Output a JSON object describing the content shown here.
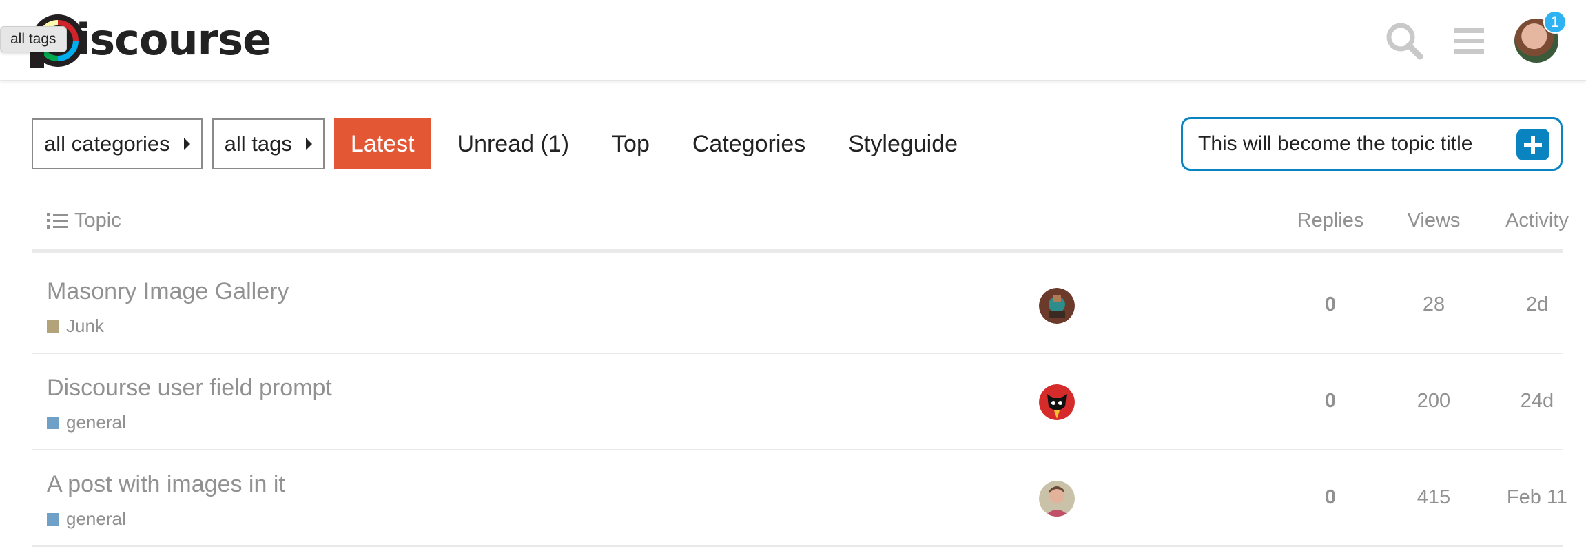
{
  "header": {
    "logo_text": "iscourse",
    "tooltip": "all tags",
    "notification_count": "1"
  },
  "nav": {
    "categories_dropdown": "all categories",
    "tags_dropdown": "all tags",
    "links": [
      "Latest",
      "Unread (1)",
      "Top",
      "Categories",
      "Styleguide"
    ],
    "active": "Latest"
  },
  "composer": {
    "value": "This will become the topic title"
  },
  "table": {
    "headers": {
      "topic": "Topic",
      "replies": "Replies",
      "views": "Views",
      "activity": "Activity"
    },
    "rows": [
      {
        "title": "Masonry Image Gallery",
        "category": "Junk",
        "category_color": "#b3a37a",
        "replies": "0",
        "views": "28",
        "activity": "2d"
      },
      {
        "title": "Discourse user field prompt",
        "category": "general",
        "category_color": "#6fa0c8",
        "replies": "0",
        "views": "200",
        "activity": "24d"
      },
      {
        "title": "A post with images in it",
        "category": "general",
        "category_color": "#6fa0c8",
        "replies": "0",
        "views": "415",
        "activity": "Feb 11"
      }
    ]
  },
  "colors": {
    "accent": "#e45735",
    "composer_border": "#0a84c1",
    "notification": "#2eb2f2"
  }
}
